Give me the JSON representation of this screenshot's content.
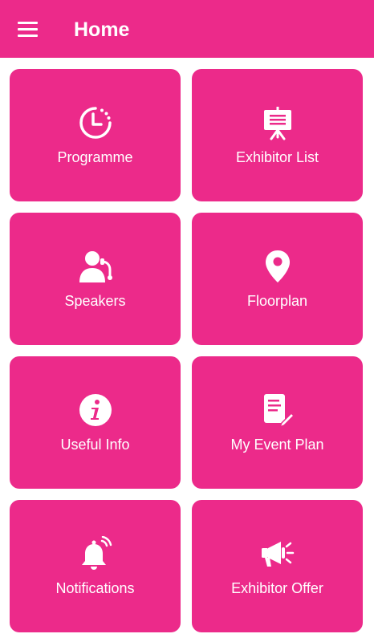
{
  "app": {
    "title": "Home",
    "accent_color": "#ec2a8a",
    "menu_icon": "hamburger-menu-icon"
  },
  "tiles": [
    {
      "label": "Programme",
      "icon": "clock-icon"
    },
    {
      "label": "Exhibitor List",
      "icon": "presentation-board-icon"
    },
    {
      "label": "Speakers",
      "icon": "speaker-person-icon"
    },
    {
      "label": "Floorplan",
      "icon": "map-pin-icon"
    },
    {
      "label": "Useful Info",
      "icon": "info-icon"
    },
    {
      "label": "My Event Plan",
      "icon": "notepad-pencil-icon"
    },
    {
      "label": "Notifications",
      "icon": "bell-icon"
    },
    {
      "label": "Exhibitor Offer",
      "icon": "megaphone-icon"
    }
  ]
}
